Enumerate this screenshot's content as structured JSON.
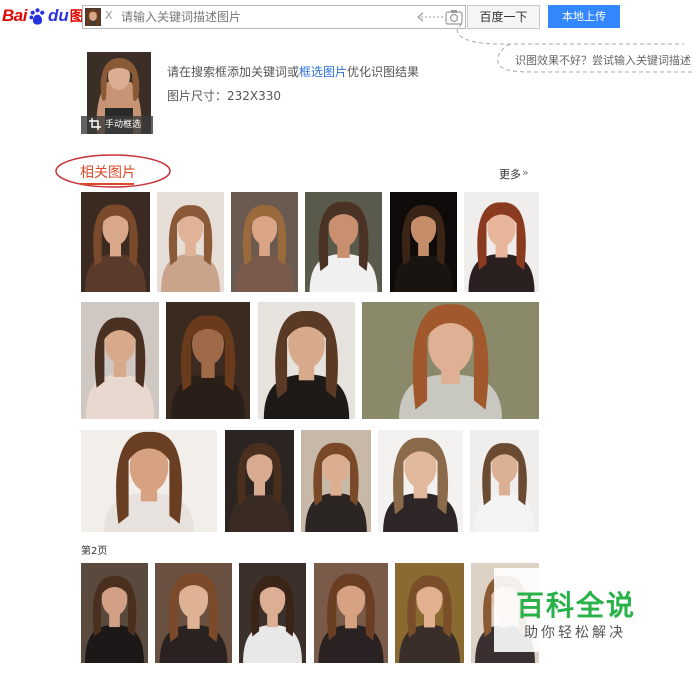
{
  "header": {
    "logo_bai": "Bai",
    "logo_du": "du",
    "logo_pic": "图片",
    "thumb_close": "X",
    "search_placeholder": "请输入关键词描述图片",
    "search_button": "百度一下",
    "upload_button": "本地上传",
    "tip": "识图效果不好？尝试输入关键词描述"
  },
  "query": {
    "manual_select": "手动框选",
    "hint_prefix": "请在搜索框添加关键词或",
    "hint_link": "框选图片",
    "hint_suffix": "优化识图结果",
    "size_text": "图片尺寸：232X330"
  },
  "related": {
    "title": "相关图片",
    "more": "更多",
    "more_icon": "»",
    "page2": "第2页"
  },
  "watermark": {
    "main": "百科全说",
    "sub": "助你轻松解决"
  },
  "colors": {
    "brand_red": "#e10602",
    "brand_blue": "#2932e1",
    "upload_blue": "#3388ff",
    "accent_orange": "#d94b2a",
    "watermark_green": "#2ab24a"
  }
}
